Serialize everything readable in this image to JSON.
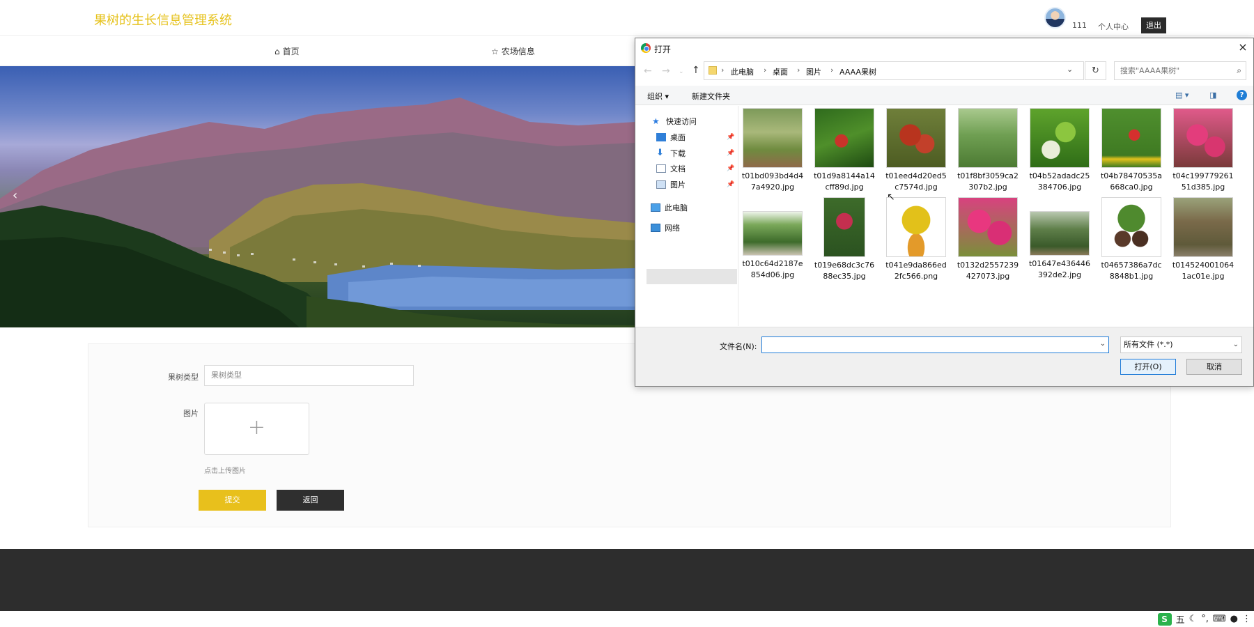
{
  "site": {
    "title": "果树的生长信息管理系统",
    "user_name": "111",
    "user_center": "个人中心",
    "logout": "退出"
  },
  "nav": {
    "home": "首页",
    "farm_info": "农场信息"
  },
  "form": {
    "type_label": "果树类型",
    "type_placeholder": "果树类型",
    "image_label": "图片",
    "upload_plus": "+",
    "upload_hint": "点击上传图片",
    "submit": "提交",
    "back": "返回"
  },
  "dialog": {
    "title": "打开",
    "close": "×",
    "breadcrumb": [
      "此电脑",
      "桌面",
      "图片",
      "AAAA果树"
    ],
    "search_placeholder": "搜索\"AAAA果树\"",
    "toolbar": {
      "organize": "组织",
      "new_folder": "新建文件夹"
    },
    "sidebar": {
      "quick_access": "快速访问",
      "desktop": "桌面",
      "downloads": "下载",
      "documents": "文档",
      "pictures": "图片",
      "this_pc": "此电脑",
      "network": "网络"
    },
    "files": [
      "t01bd093bd4d47a4920.jpg",
      "t01d9a8144a14cff89d.jpg",
      "t01eed4d20ed5c7574d.jpg",
      "t01f8bf3059ca2307b2.jpg",
      "t04b52adadc25384706.jpg",
      "t04b78470535a668ca0.jpg",
      "t04c19977926151d385.jpg",
      "t010c64d2187e854d06.jpg",
      "t019e68dc3c7688ec35.jpg",
      "t041e9da866ed2fc566.png",
      "t0132d2557239427073.jpg",
      "t01647e436446392de2.jpg",
      "t04657386a7dc8848b1.jpg",
      "t0145240010641ac01e.jpg"
    ],
    "filename_label": "文件名(N):",
    "filename_value": "",
    "filetype": "所有文件 (*.*)",
    "open_button": "打开(O)",
    "cancel_button": "取消"
  },
  "tray": {
    "ime": "五"
  },
  "colors": {
    "brand_yellow": "#e8c01c",
    "dark": "#2d2d2d",
    "dialog_accent": "#1e7bd8"
  }
}
